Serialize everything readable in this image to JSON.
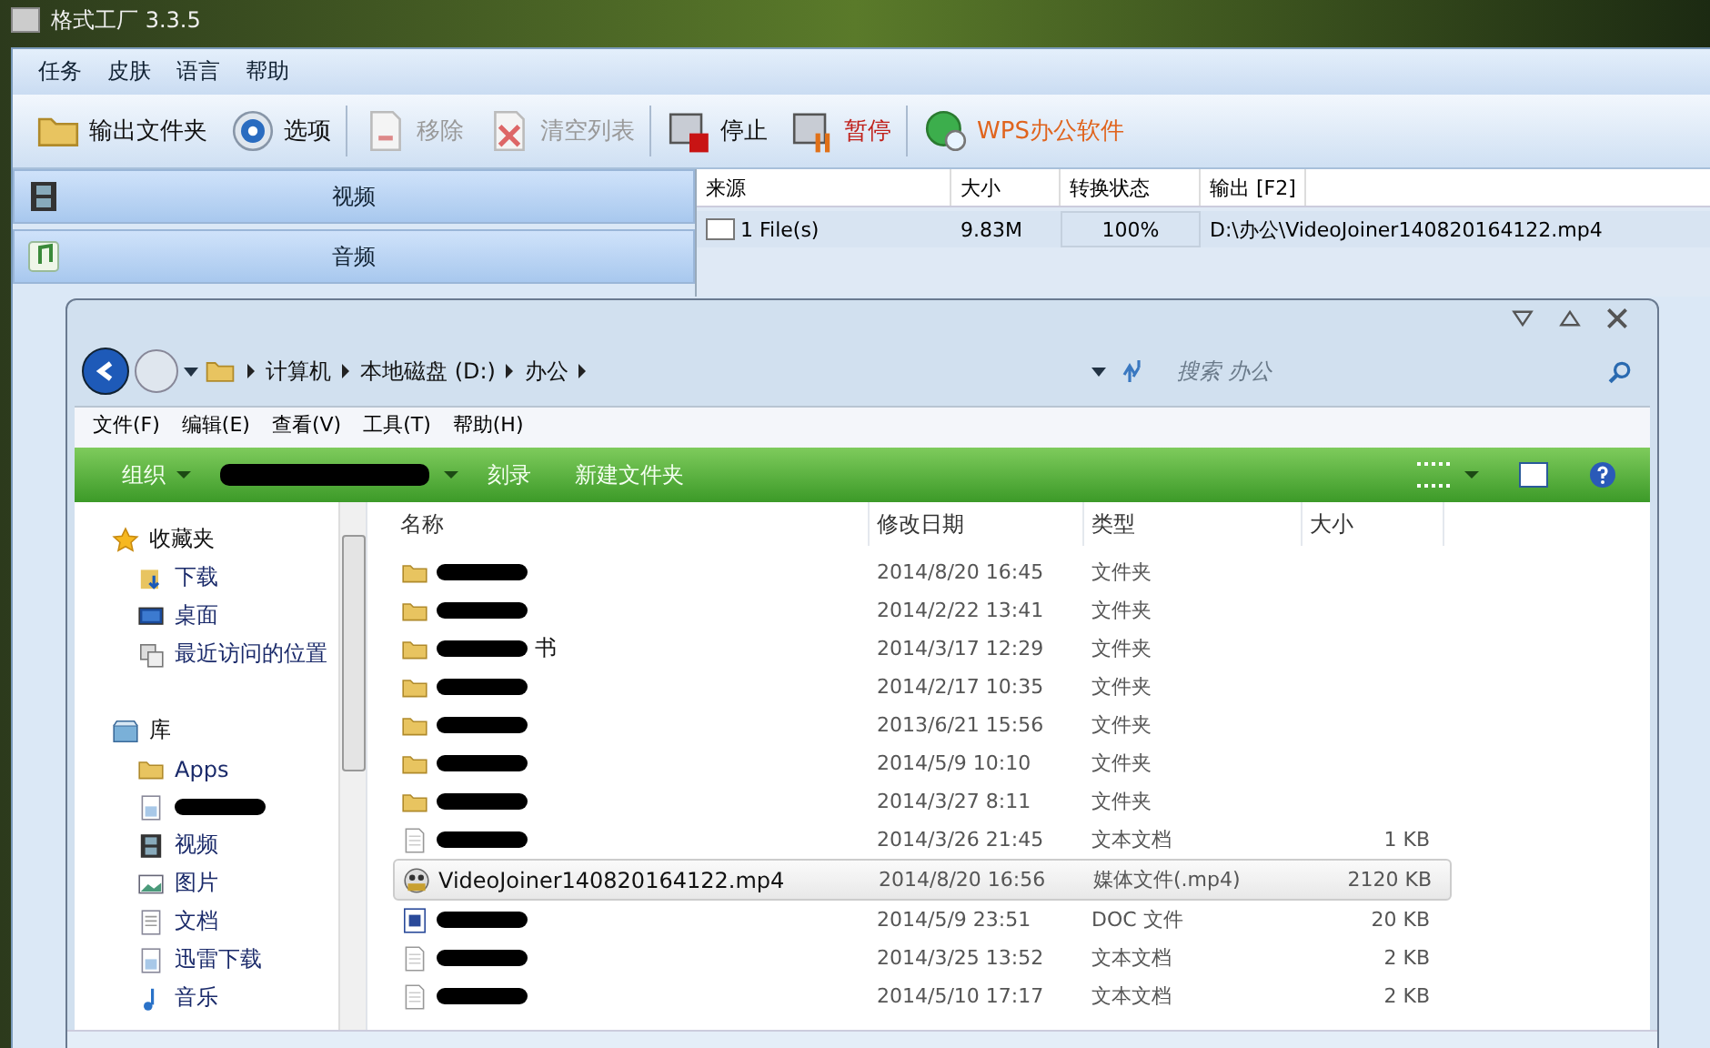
{
  "app": {
    "title": "格式工厂 3.3.5",
    "menu": [
      "任务",
      "皮肤",
      "语言",
      "帮助"
    ],
    "toolbar": [
      {
        "label": "输出文件夹",
        "kind": "folder",
        "disabled": false
      },
      {
        "label": "选项",
        "kind": "gear",
        "disabled": false
      },
      {
        "label": "移除",
        "kind": "remove",
        "disabled": true
      },
      {
        "label": "清空列表",
        "kind": "clear",
        "disabled": true
      },
      {
        "label": "停止",
        "kind": "stop",
        "disabled": false
      },
      {
        "label": "暂停",
        "kind": "pause",
        "disabled": false,
        "color": "#c0201a"
      },
      {
        "label": "WPS办公软件",
        "kind": "globe",
        "disabled": false,
        "color": "#e0641e"
      }
    ],
    "categories": [
      {
        "label": "视频",
        "kind": "film"
      },
      {
        "label": "音频",
        "kind": "music"
      }
    ],
    "tasks": {
      "columns": [
        "来源",
        "大小",
        "转换状态",
        "输出 [F2]"
      ],
      "rows": [
        {
          "source": "1 File(s)",
          "size": "9.83M",
          "status": "100%",
          "output": "D:\\办公\\VideoJoiner140820164122.mp4"
        }
      ]
    }
  },
  "explorer": {
    "breadcrumb": [
      "计算机",
      "本地磁盘 (D:)",
      "办公"
    ],
    "search": {
      "placeholder": "搜索 办公"
    },
    "menu": [
      "文件(F)",
      "编辑(E)",
      "查看(V)",
      "工具(T)",
      "帮助(H)"
    ],
    "toolbar": [
      {
        "label": "组织",
        "kind": "dropdown"
      },
      {
        "kind": "redacted"
      },
      {
        "label": "刻录",
        "kind": "plain"
      },
      {
        "label": "新建文件夹",
        "kind": "plain"
      }
    ],
    "nav": [
      {
        "label": "收藏夹",
        "kind": "group"
      },
      {
        "label": "下载",
        "kind": "item"
      },
      {
        "label": "桌面",
        "kind": "item"
      },
      {
        "label": "最近访问的位置",
        "kind": "item"
      },
      {
        "label": "库",
        "kind": "group"
      },
      {
        "label": "Apps",
        "kind": "item"
      },
      {
        "kind": "redacted"
      },
      {
        "label": "视频",
        "kind": "item"
      },
      {
        "label": "图片",
        "kind": "item"
      },
      {
        "label": "文档",
        "kind": "item"
      },
      {
        "label": "迅雷下载",
        "kind": "item"
      },
      {
        "label": "音乐",
        "kind": "item"
      }
    ],
    "columns": [
      "名称",
      "修改日期",
      "类型",
      "大小"
    ],
    "rows": [
      {
        "kind": "folder",
        "redacted": true,
        "date": "2014/8/20 16:45",
        "type": "文件夹",
        "selected": false
      },
      {
        "kind": "folder",
        "redacted": true,
        "date": "2014/2/22 13:41",
        "type": "文件夹",
        "selected": false
      },
      {
        "kind": "folder",
        "redacted": true,
        "name": "书",
        "date": "2014/3/17 12:29",
        "type": "文件夹",
        "selected": false
      },
      {
        "kind": "folder",
        "redacted": true,
        "date": "2014/2/17 10:35",
        "type": "文件夹",
        "selected": false
      },
      {
        "kind": "folder",
        "redacted": true,
        "date": "2013/6/21 15:56",
        "type": "文件夹",
        "selected": false
      },
      {
        "kind": "folder",
        "redacted": true,
        "date": "2014/5/9 10:10",
        "type": "文件夹",
        "selected": false
      },
      {
        "kind": "folder",
        "redacted": true,
        "date": "2014/3/27 8:11",
        "type": "文件夹",
        "selected": false
      },
      {
        "kind": "text",
        "redacted": true,
        "date": "2014/3/26 21:45",
        "type": "文本文档",
        "size": "1 KB",
        "selected": false
      },
      {
        "kind": "media",
        "redacted": false,
        "name": "VideoJoiner140820164122.mp4",
        "date": "2014/8/20 16:56",
        "type": "媒体文件(.mp4)",
        "size": "2120 KB",
        "selected": true
      },
      {
        "kind": "doc",
        "redacted": true,
        "date": "2014/5/9 23:51",
        "type": "DOC 文件",
        "size": "20 KB",
        "selected": false
      },
      {
        "kind": "text",
        "redacted": true,
        "date": "2014/3/25 13:52",
        "type": "文本文档",
        "size": "2 KB",
        "selected": false
      },
      {
        "kind": "text",
        "redacted": true,
        "date": "2014/5/10 17:17",
        "type": "文本文档",
        "size": "2 KB",
        "selected": false
      }
    ]
  }
}
